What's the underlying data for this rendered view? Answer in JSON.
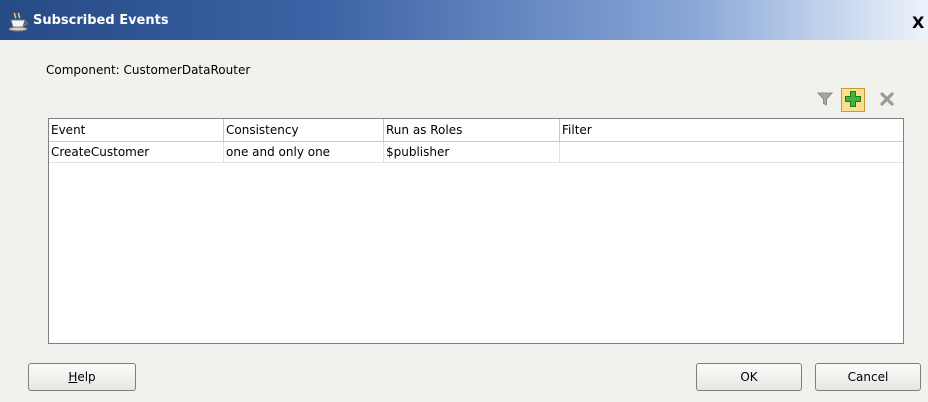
{
  "window": {
    "title": "Subscribed Events",
    "close_glyph": "X"
  },
  "component": {
    "label": "Component:",
    "value": "CustomerDataRouter"
  },
  "toolbar": {
    "filter_icon": "filter-icon",
    "add_icon": "add-icon",
    "delete_icon": "delete-icon"
  },
  "table": {
    "columns": [
      "Event",
      "Consistency",
      "Run as Roles",
      "Filter"
    ],
    "rows": [
      [
        "CreateCustomer",
        "one and only one",
        "$publisher",
        ""
      ]
    ]
  },
  "buttons": {
    "help_mnemonic": "H",
    "help_rest": "elp",
    "ok": "OK",
    "cancel": "Cancel"
  },
  "colors": {
    "title_bar_start": "#264a85",
    "title_bar_end": "#eef3fb",
    "dialog_bg": "#f1f1ee",
    "add_button_bg": "#fbdf8c",
    "add_icon": "#2e9e2e"
  }
}
